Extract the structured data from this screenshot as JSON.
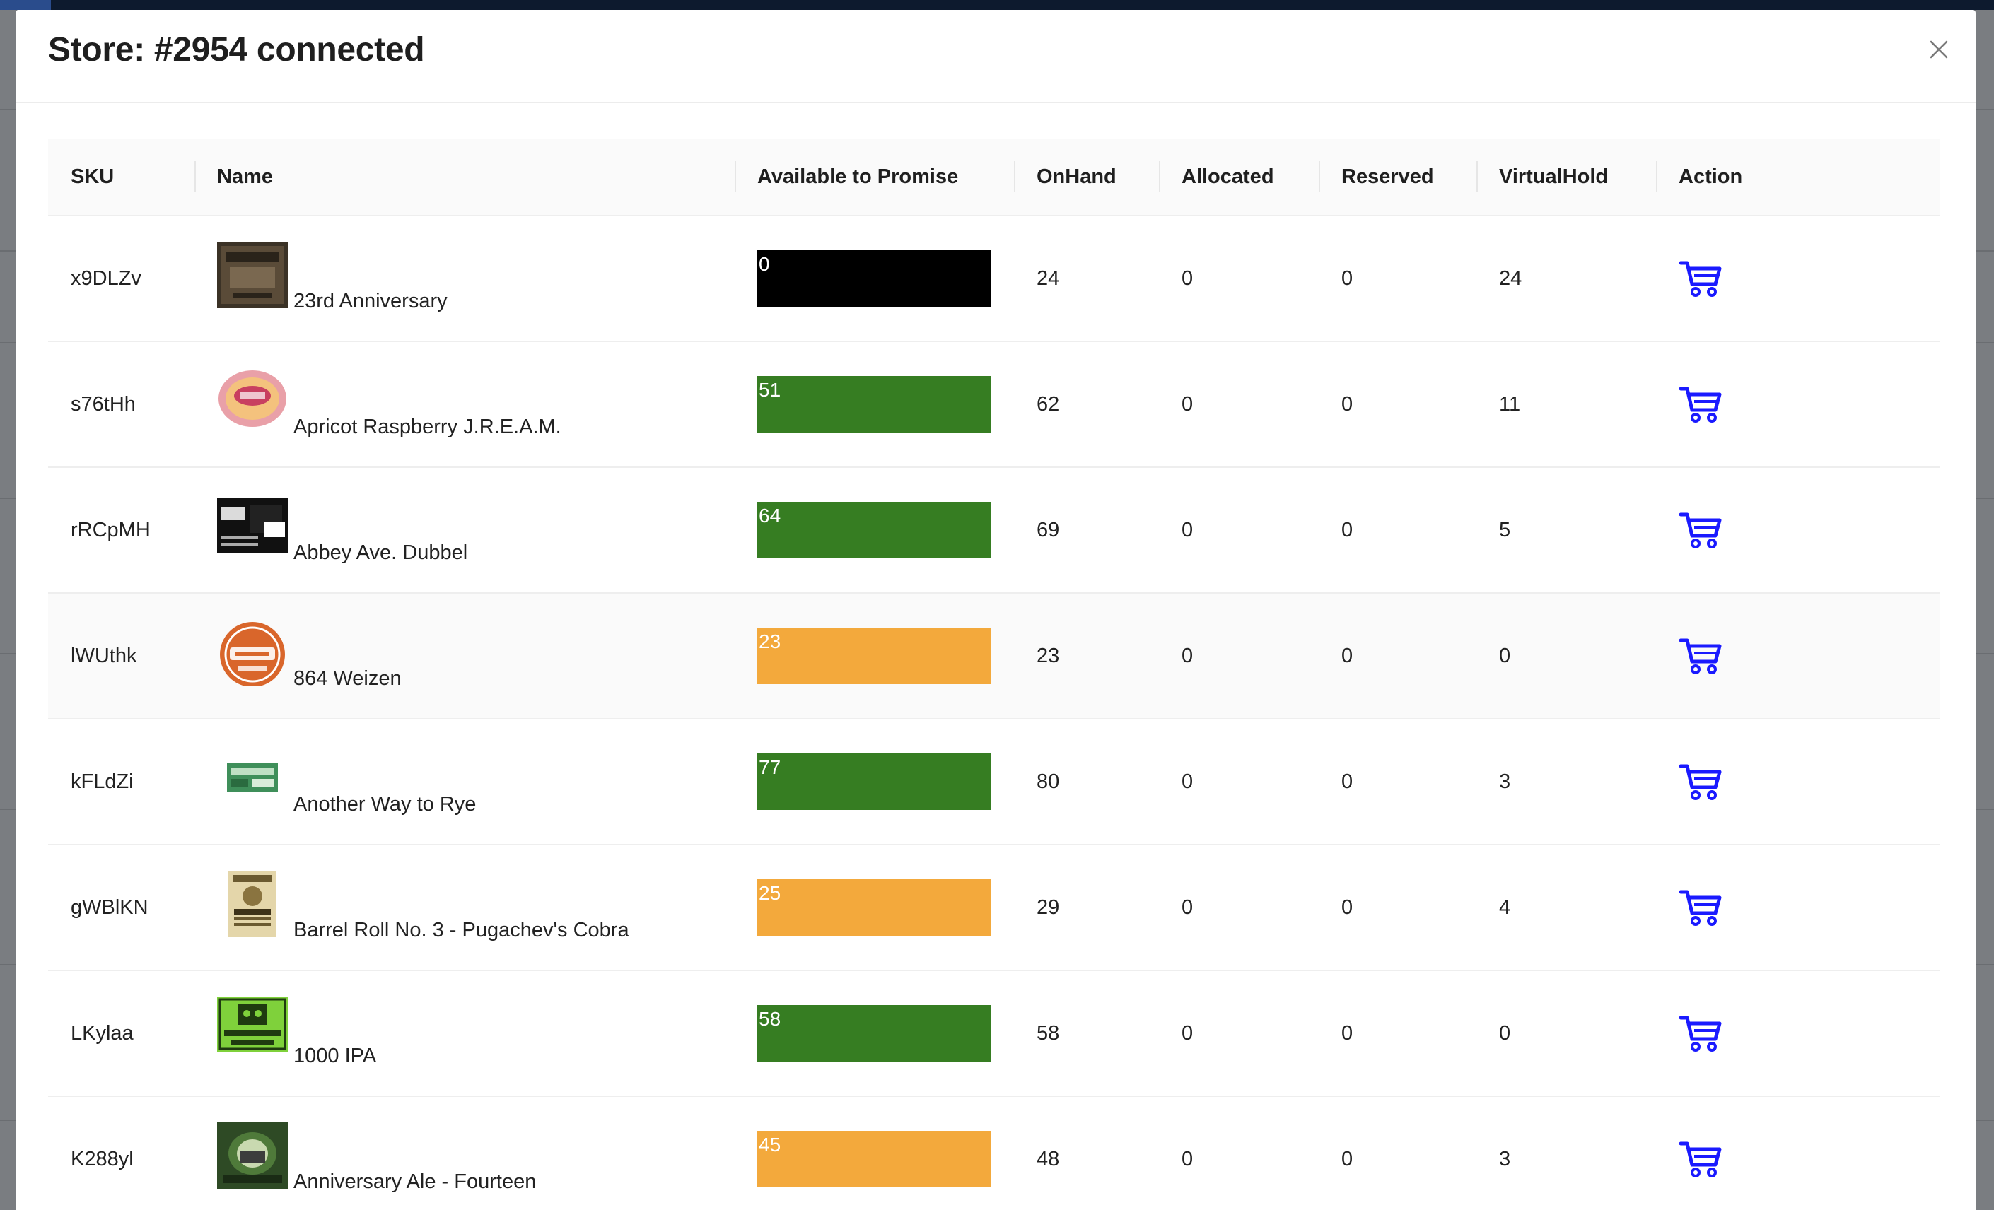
{
  "modal": {
    "title": "Store: #2954 connected"
  },
  "table": {
    "columns": {
      "sku": "SKU",
      "name": "Name",
      "atp": "Available to Promise",
      "onhand": "OnHand",
      "allocated": "Allocated",
      "reserved": "Reserved",
      "virtualhold": "VirtualHold",
      "action": "Action"
    },
    "rows": [
      {
        "sku": "x9DLZv",
        "name": "23rd Anniversary",
        "atp": "0",
        "onhand": "24",
        "allocated": "0",
        "reserved": "0",
        "virtualhold": "24",
        "atp_color": "#000000",
        "thumb_icon": "beer-label-23rd-anniversary"
      },
      {
        "sku": "s76tHh",
        "name": "Apricot Raspberry J.R.E.A.M.",
        "atp": "51",
        "onhand": "62",
        "allocated": "0",
        "reserved": "0",
        "virtualhold": "11",
        "atp_color": "#367d22",
        "thumb_icon": "beer-label-jream"
      },
      {
        "sku": "rRCpMH",
        "name": "Abbey Ave. Dubbel",
        "atp": "64",
        "onhand": "69",
        "allocated": "0",
        "reserved": "0",
        "virtualhold": "5",
        "atp_color": "#367d22",
        "thumb_icon": "beer-label-great-lakes"
      },
      {
        "sku": "lWUthk",
        "name": "864 Weizen",
        "atp": "23",
        "onhand": "23",
        "allocated": "0",
        "reserved": "0",
        "virtualhold": "0",
        "atp_color": "#f3a93c",
        "thumb_icon": "beer-label-weizen"
      },
      {
        "sku": "kFLdZi",
        "name": "Another Way to Rye",
        "atp": "77",
        "onhand": "80",
        "allocated": "0",
        "reserved": "0",
        "virtualhold": "3",
        "atp_color": "#367d22",
        "thumb_icon": "beer-label-rye"
      },
      {
        "sku": "gWBlKN",
        "name": "Barrel Roll No. 3 - Pugachev's Cobra",
        "atp": "25",
        "onhand": "29",
        "allocated": "0",
        "reserved": "0",
        "virtualhold": "4",
        "atp_color": "#f3a93c",
        "thumb_icon": "beer-label-barrel-roll"
      },
      {
        "sku": "LKylaa",
        "name": "1000 IPA",
        "atp": "58",
        "onhand": "58",
        "allocated": "0",
        "reserved": "0",
        "virtualhold": "0",
        "atp_color": "#367d22",
        "thumb_icon": "beer-label-1000-ipa"
      },
      {
        "sku": "K288yl",
        "name": "Anniversary Ale - Fourteen",
        "atp": "45",
        "onhand": "48",
        "allocated": "0",
        "reserved": "0",
        "virtualhold": "3",
        "atp_color": "#f3a93c",
        "thumb_icon": "beer-label-anniversary-ale"
      }
    ]
  },
  "icons": {
    "close": "close-icon",
    "cart": "cart-icon"
  },
  "colors": {
    "atp_zero": "#000000",
    "atp_good": "#367d22",
    "atp_low": "#f3a93c",
    "cart": "#1a1aff"
  }
}
